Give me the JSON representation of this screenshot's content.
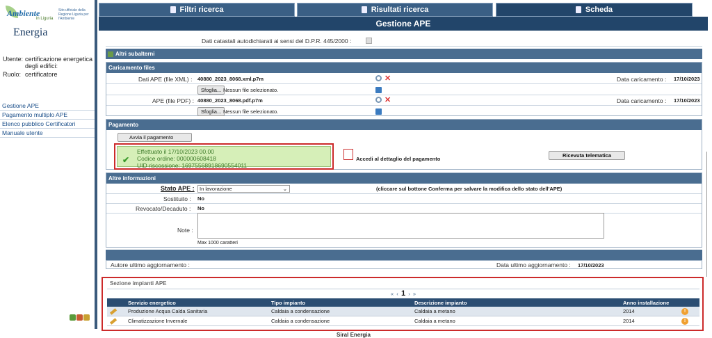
{
  "sidebar": {
    "logo_word": "Ambiente",
    "logo_sub": "in Liguria",
    "logo_tag": "Sito ufficiale della Regione Liguria per l'Ambiente",
    "section_title": "Energia",
    "user_label": "Utente:",
    "user_value": "certificazione energetica degli edifici:",
    "role_label": "Ruolo:",
    "role_value": "certificatore",
    "nav": [
      "Gestione APE",
      "Pagamento multiplo APE",
      "Elenco pubblico Certificatori",
      "Manuale utente"
    ]
  },
  "tabs": [
    {
      "label": "Filtri ricerca",
      "icon": "document-icon"
    },
    {
      "label": "Risultati ricerca",
      "icon": "documents-icon"
    },
    {
      "label": "Scheda",
      "icon": "document-icon"
    }
  ],
  "page_title": "Gestione APE",
  "catastali": {
    "label": "Dati catastali autodichiarati ai sensi del D.P.R. 445/2000 :"
  },
  "altri_subalterni": "Altri subalterni",
  "caricamento": {
    "header": "Caricamento files",
    "xml_label": "Dati APE (file XML) :",
    "xml_file": "40880_2023_8068.xml.p7m",
    "pdf_label": "APE (file PDF) :",
    "pdf_file": "40880_2023_8068.pdf.p7m",
    "browse_label": "Sfoglia...",
    "no_file": "Nessun file selezionato.",
    "date_label": "Data caricamento :",
    "date_value": "17/10/2023"
  },
  "pagamento": {
    "header": "Pagamento",
    "start_button": "Avvia il pagamento",
    "line1": "Effettuato il 17/10/2023 00.00",
    "line2": "Codice ordine: 000000608418",
    "line3": "UID riscossione: 16975568918690554011",
    "detail_link": "Accedi al dettaglio del pagamento",
    "receipt_button": "Ricevuta telematica"
  },
  "altre": {
    "header": "Altre informazioni",
    "stato_label": "Stato APE :",
    "stato_value": "In lavorazione",
    "stato_hint": "(cliccare sul bottone Conferma per salvare la modifica dello stato dell'APE)",
    "sostituito_label": "Sostituito :",
    "sostituito_value": "No",
    "revocato_label": "Revocato/Decaduto :",
    "revocato_value": "No",
    "note_label": "Note :",
    "note_limit": "Max 1000 caratteri"
  },
  "aggiornamento": {
    "autore_label": "Autore ultimo aggiornamento :",
    "data_label": "Data ultimo aggiornamento :",
    "data_value": "17/10/2023"
  },
  "impianti": {
    "title": "Sezione impianti APE",
    "pager_first": "«",
    "pager_prev": "‹",
    "pager_page": "1",
    "pager_next": "›",
    "pager_last": "»",
    "headers": [
      "Servizio energetico",
      "Tipo impianto",
      "Descrizione impianto",
      "Anno installazione"
    ],
    "rows": [
      [
        "Produzione Acqua Calda Sanitaria",
        "Caldaia a condensazione",
        "Caldaia a metano",
        "2014"
      ],
      [
        "Climatizzazione Invernale",
        "Caldaia a condensazione",
        "Caldaia a metano",
        "2014"
      ]
    ]
  },
  "footer": "Siral Energia"
}
